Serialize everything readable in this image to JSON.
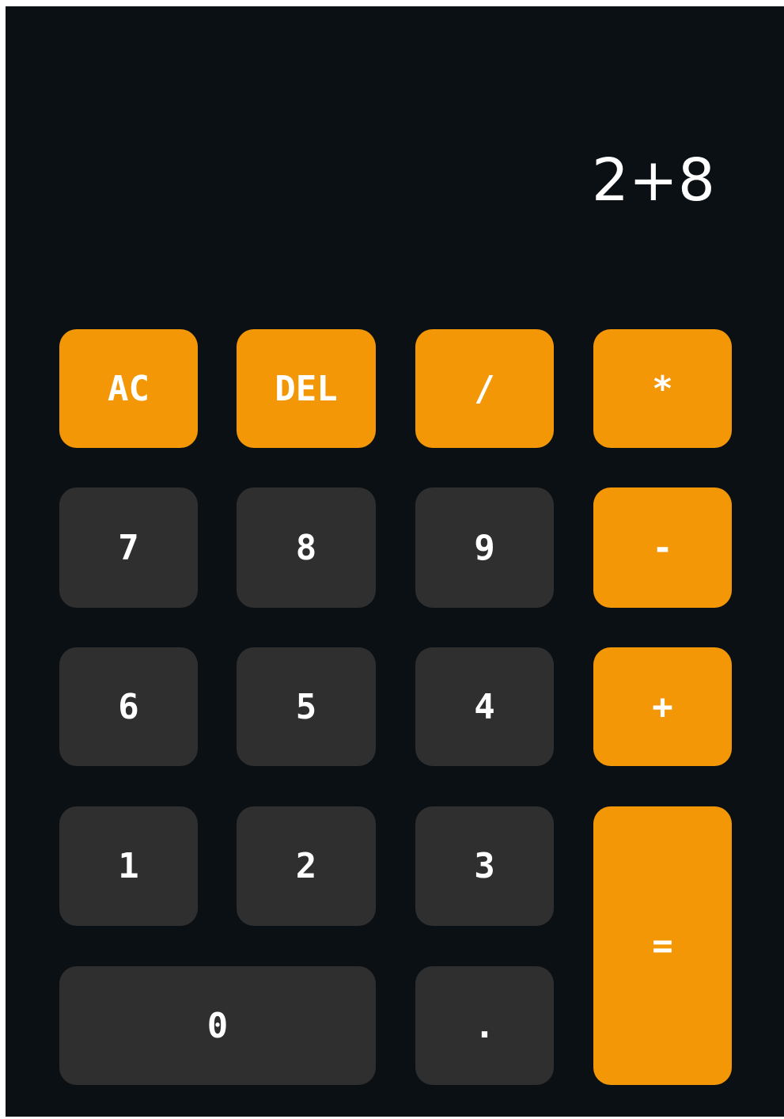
{
  "display": {
    "expression": "2+8"
  },
  "keys": {
    "ac": "AC",
    "del": "DEL",
    "divide": "/",
    "multiply": "*",
    "seven": "7",
    "eight": "8",
    "nine": "9",
    "minus": "-",
    "six": "6",
    "five": "5",
    "four": "4",
    "plus": "+",
    "one": "1",
    "two": "2",
    "three": "3",
    "equals": "=",
    "zero": "0",
    "decimal": "."
  },
  "colors": {
    "background": "#0a1013",
    "operator_key": "#f39707",
    "number_key": "#2f2f2f",
    "text": "#ffffff"
  }
}
